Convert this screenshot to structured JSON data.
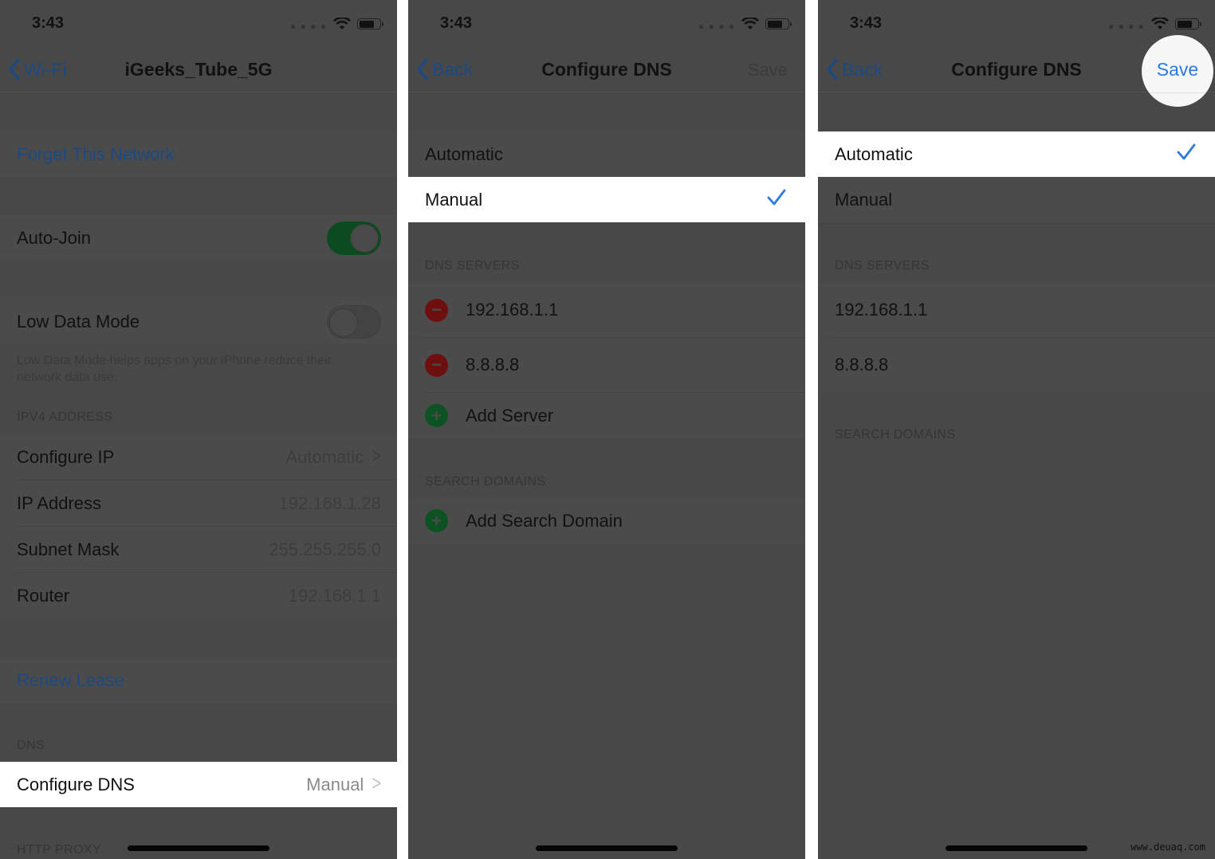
{
  "status_bar": {
    "time": "3:43",
    "signal_icon": "cellular-dots-icon",
    "wifi_icon": "wifi-icon",
    "battery_icon": "battery-icon"
  },
  "colors": {
    "accent_blue": "#2a7ae0",
    "toggle_green": "#0b4b1f",
    "minus_red": "#6e0f0f",
    "plus_green": "#0d5222",
    "dim_bg": "#484849"
  },
  "screen1": {
    "back_label": "Wi-Fi",
    "title": "iGeeks_Tube_5G",
    "forget_network": "Forget This Network",
    "auto_join": {
      "label": "Auto-Join",
      "on": true
    },
    "low_data_mode": {
      "label": "Low Data Mode",
      "on": false
    },
    "low_data_footer": "Low Data Mode helps apps on your iPhone reduce their network data use.",
    "ipv4_header": "IPV4 ADDRESS",
    "ipv4_rows": [
      {
        "label": "Configure IP",
        "value": "Automatic",
        "chevron": true
      },
      {
        "label": "IP Address",
        "value": "192.168.1.28"
      },
      {
        "label": "Subnet Mask",
        "value": "255.255.255.0"
      },
      {
        "label": "Router",
        "value": "192.168.1.1"
      }
    ],
    "renew_lease": "Renew Lease",
    "dns_header": "DNS",
    "configure_dns": {
      "label": "Configure DNS",
      "value": "Manual"
    },
    "http_proxy_header": "HTTP PROXY"
  },
  "screen2": {
    "back_label": "Back",
    "title": "Configure DNS",
    "save_label": "Save",
    "save_enabled": false,
    "options": [
      {
        "label": "Automatic",
        "selected": false
      },
      {
        "label": "Manual",
        "selected": true
      }
    ],
    "dns_servers_header": "DNS SERVERS",
    "servers": [
      "192.168.1.1",
      "8.8.8.8"
    ],
    "add_server": "Add Server",
    "search_domains_header": "SEARCH DOMAINS",
    "add_search_domain": "Add Search Domain"
  },
  "screen3": {
    "back_label": "Back",
    "title": "Configure DNS",
    "save_label": "Save",
    "save_enabled": true,
    "options": [
      {
        "label": "Automatic",
        "selected": true
      },
      {
        "label": "Manual",
        "selected": false
      }
    ],
    "dns_servers_header": "DNS SERVERS",
    "servers": [
      "192.168.1.1",
      "8.8.8.8"
    ],
    "search_domains_header": "SEARCH DOMAINS"
  },
  "watermark": "www.deuaq.com"
}
